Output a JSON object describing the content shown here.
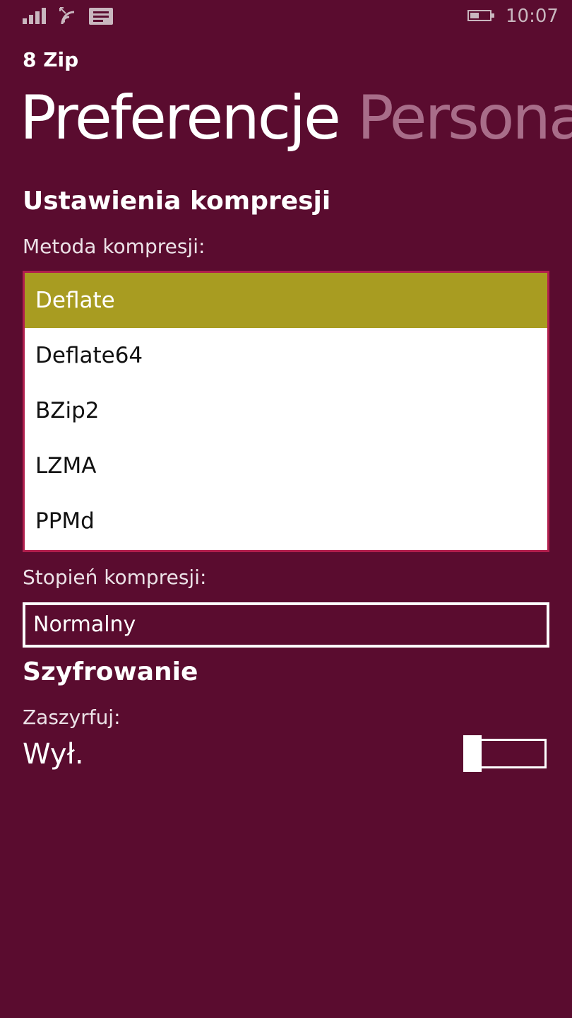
{
  "status_bar": {
    "time": "10:07",
    "icons": [
      "signal-strength-icon",
      "wifi-icon",
      "message-icon",
      "battery-icon"
    ]
  },
  "app": {
    "name": "8 Zip"
  },
  "pivot": {
    "active": "Preferencje",
    "next": "Personalizacja"
  },
  "compression": {
    "heading": "Ustawienia kompresji",
    "method_label": "Metoda kompresji:",
    "methods": [
      "Deflate",
      "Deflate64",
      "BZip2",
      "LZMA",
      "PPMd"
    ],
    "selected_method": "Deflate",
    "level_label": "Stopień kompresji:",
    "level_value": "Normalny"
  },
  "encryption": {
    "heading": "Szyfrowanie",
    "toggle_label": "Zaszyrfuj:",
    "toggle_value": "Wył.",
    "toggle_on": false
  },
  "colors": {
    "background": "#5a0c2f",
    "accent_selection": "#a89c21",
    "list_border": "#b11f4d",
    "inactive_pivot": "#a86d89"
  }
}
